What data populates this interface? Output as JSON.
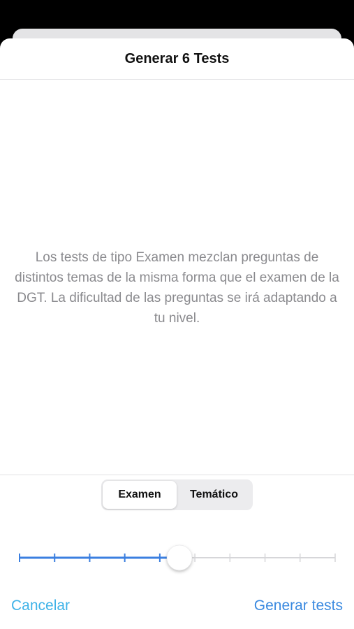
{
  "header": {
    "title": "Generar 6 Tests"
  },
  "content": {
    "description": "Los tests de tipo Examen mezclan preguntas de distintos temas de la misma forma que el examen de la DGT. La dificultad de las preguntas se irá adaptando a tu nivel."
  },
  "segmented_control": {
    "options": [
      "Examen",
      "Temático"
    ],
    "selected": "Examen"
  },
  "slider": {
    "steps": 10,
    "value": 6,
    "min": 1,
    "max": 10,
    "active_color": "#3b7fe0",
    "inactive_color": "#d6d6d9"
  },
  "footer": {
    "cancel_label": "Cancelar",
    "generate_label": "Generar tests"
  },
  "colors": {
    "accent": "#3b8ae0",
    "cancel": "#3fb3e8"
  }
}
